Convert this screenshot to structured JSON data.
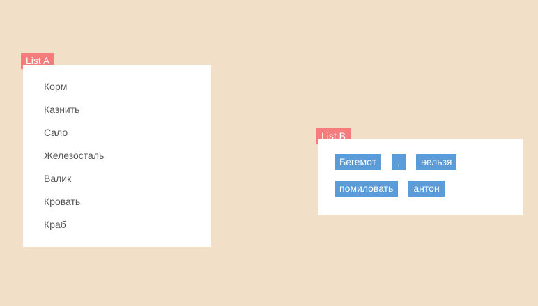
{
  "list_a": {
    "label": "List A",
    "items": [
      {
        "label": "Корм"
      },
      {
        "label": "Казнить"
      },
      {
        "label": "Сало"
      },
      {
        "label": "Железосталь"
      },
      {
        "label": "Валик"
      },
      {
        "label": "Кровать"
      },
      {
        "label": "Краб"
      }
    ]
  },
  "list_b": {
    "label": "List B",
    "rows": [
      [
        {
          "label": "Бегемот"
        },
        {
          "label": ","
        },
        {
          "label": "нельзя"
        }
      ],
      [
        {
          "label": "помиловать"
        },
        {
          "label": "антон"
        }
      ]
    ]
  },
  "colors": {
    "background": "#f2dfc7",
    "panel": "#ffffff",
    "label_tag": "#f47c7c",
    "chip": "#5b9bd8",
    "item_text": "#555555"
  }
}
